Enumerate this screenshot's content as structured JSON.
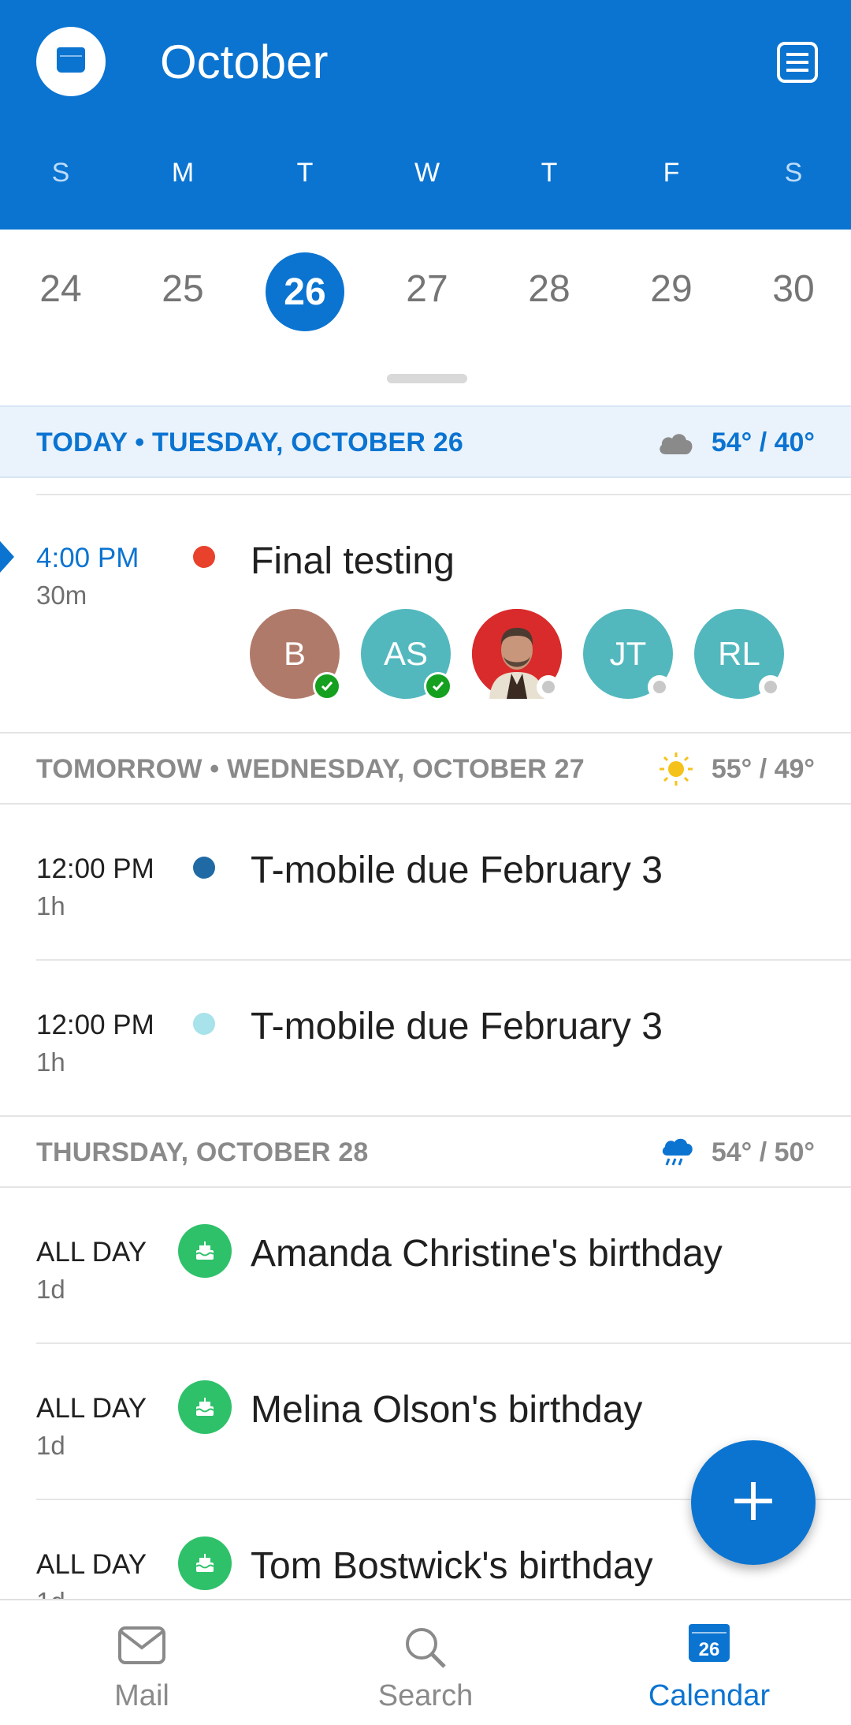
{
  "header": {
    "month": "October",
    "calendar_icon": "calendar-icon",
    "agenda_icon": "agenda-view-icon",
    "days_of_week": [
      "S",
      "M",
      "T",
      "W",
      "T",
      "F",
      "S"
    ],
    "brand_color": "#0b74d1"
  },
  "week": {
    "dates": [
      "24",
      "25",
      "26",
      "27",
      "28",
      "29",
      "30"
    ],
    "selected_date": "26"
  },
  "today": {
    "label": "TODAY • TUESDAY, OCTOBER 26",
    "weather_icon": "cloud-icon",
    "temps": "54° / 40°",
    "event": {
      "time": "4:00 PM",
      "duration": "30m",
      "title": "Final testing",
      "dot_color": "#e8412c",
      "attendees": [
        {
          "initials": "B",
          "color": "#b07a6a",
          "status": "accepted"
        },
        {
          "initials": "AS",
          "color": "#52b8be",
          "status": "accepted"
        },
        {
          "initials": "",
          "color": "#d92b2b",
          "status": "unknown",
          "photo": true
        },
        {
          "initials": "JT",
          "color": "#52b8be",
          "status": "unknown"
        },
        {
          "initials": "RL",
          "color": "#52b8be",
          "status": "unknown"
        }
      ]
    }
  },
  "tomorrow": {
    "label": "TOMORROW • WEDNESDAY, OCTOBER 27",
    "weather_icon": "sun-icon",
    "temps": "55° / 49°",
    "events": [
      {
        "time": "12:00 PM",
        "duration": "1h",
        "title": "T-mobile due February 3",
        "dot_color": "#1f6aa5"
      },
      {
        "time": "12:00 PM",
        "duration": "1h",
        "title": "T-mobile due February 3",
        "dot_color": "#a8e2ea"
      }
    ]
  },
  "thursday": {
    "label": "THURSDAY, OCTOBER 28",
    "weather_icon": "rain-cloud-icon",
    "temps": "54° / 50°",
    "events": [
      {
        "time": "ALL DAY",
        "duration": "1d",
        "title": "Amanda Christine's birthday",
        "icon": "birthday-cake-icon"
      },
      {
        "time": "ALL DAY",
        "duration": "1d",
        "title": "Melina Olson's birthday",
        "icon": "birthday-cake-icon"
      },
      {
        "time": "ALL DAY",
        "duration": "1d",
        "title": "Tom Bostwick's birthday",
        "icon": "birthday-cake-icon"
      }
    ]
  },
  "fab": {
    "icon": "plus-icon"
  },
  "bottom_nav": {
    "items": [
      {
        "label": "Mail",
        "icon": "mail-icon"
      },
      {
        "label": "Search",
        "icon": "search-icon"
      },
      {
        "label": "Calendar",
        "icon": "calendar-icon",
        "badge": "26",
        "active": true
      }
    ]
  }
}
